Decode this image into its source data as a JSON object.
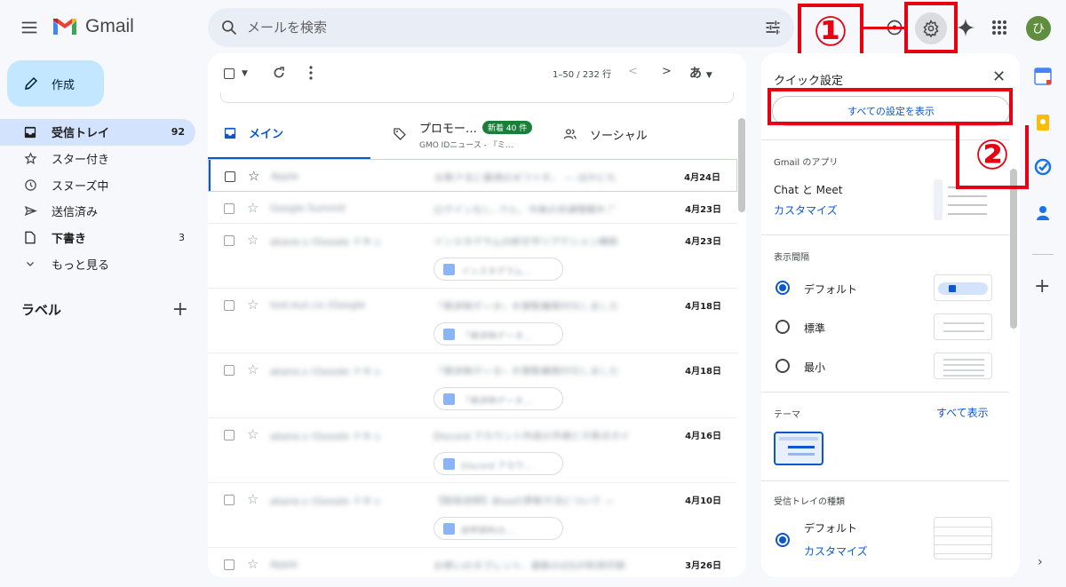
{
  "app": {
    "name": "Gmail"
  },
  "search": {
    "placeholder": "メールを検索"
  },
  "header": {
    "avatar_initial": "ひ"
  },
  "annotations": {
    "step1": "①",
    "step2": "②",
    "color": "#e60012"
  },
  "compose": {
    "label": "作成"
  },
  "nav": {
    "inbox": {
      "label": "受信トレイ",
      "count": "92"
    },
    "starred": {
      "label": "スター付き"
    },
    "snoozed": {
      "label": "スヌーズ中"
    },
    "sent": {
      "label": "送信済み"
    },
    "drafts": {
      "label": "下書き",
      "count": "3"
    },
    "more": {
      "label": "もっと見る"
    }
  },
  "labels": {
    "title": "ラベル",
    "add": "+"
  },
  "toolbar": {
    "pager": "1–50 / 232 行",
    "lang": "あ"
  },
  "tabs": {
    "main": {
      "label": "メイン"
    },
    "promo": {
      "title": "プロモー…",
      "badge": "新着 40 件",
      "subtitle": "GMO IDニュース - 『ミ…"
    },
    "social": {
      "label": "ソーシャル"
    }
  },
  "emails": [
    {
      "sender": "Apple",
      "subject": "お客さまに最適のギフトを。 — ほかにも",
      "date": "4月24日",
      "chip": ""
    },
    {
      "sender": "Google Summit",
      "subject": "ログインなし: さん、今後の会議情報をご",
      "date": "4月23日",
      "chip": ""
    },
    {
      "sender": "akane.s (Google ドキュ",
      "subject": "インスタグラムの絵文字リアクション機能",
      "date": "4月23日",
      "chip": "インスタグラム…"
    },
    {
      "sender": "test.kun.co (Google",
      "subject": "「発送物データ」を閲覧権限付与しました",
      "date": "4月18日",
      "chip": "「発送物データ…"
    },
    {
      "sender": "akane.s (Google ドキュ",
      "subject": "「発送物データ」を閲覧権限付与しました",
      "date": "4月18日",
      "chip": "「発送物データ…"
    },
    {
      "sender": "akane.s (Google ドキュ",
      "subject": "Discord アカウント作成の手順と注意点ガイ",
      "date": "4月16日",
      "chip": "Discord アカウ…"
    },
    {
      "sender": "akane.s (Google ドキュ",
      "subject": "【取扱説明】Blogの更新方法について — ",
      "date": "4月10日",
      "chip": "説明資料の…"
    },
    {
      "sender": "Apple",
      "subject": "お使いのタブレット、最新のiOSが利用可能",
      "date": "3月26日",
      "chip": ""
    }
  ],
  "quick_settings": {
    "title": "クイック設定",
    "show_all": "すべての設定を表示",
    "apps_header": "Gmail のアプリ",
    "apps_text": "Chat と Meet",
    "apps_link": "カスタマイズ",
    "density_header": "表示間隔",
    "density_options": [
      "デフォルト",
      "標準",
      "最小"
    ],
    "density_selected": "デフォルト",
    "theme_header": "テーマ",
    "theme_link": "すべて表示",
    "inbox_header": "受信トレイの種類",
    "inbox_option": "デフォルト",
    "inbox_link": "カスタマイズ"
  },
  "side_panel": {
    "add": "+",
    "expand": "›"
  }
}
